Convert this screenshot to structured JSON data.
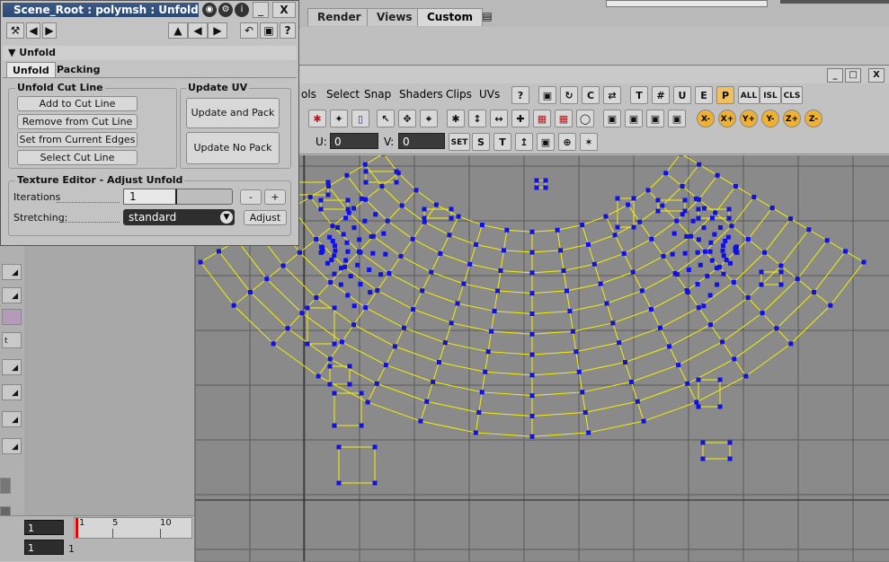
{
  "top_tabs": [
    {
      "label": "Render"
    },
    {
      "label": "Views"
    },
    {
      "label": "Custom"
    }
  ],
  "active_top_tab": "Custom",
  "panel": {
    "title": "Scene_Root : polymsh : Unfold",
    "section": "Unfold",
    "tabs": [
      "Unfold",
      "Packing"
    ],
    "cut_line": {
      "label": "Unfold Cut Line",
      "buttons": [
        "Add to Cut Line",
        "Remove from Cut Line",
        "Set from Current Edges",
        "Select Cut Line"
      ]
    },
    "update_uv": {
      "label": "Update UV",
      "buttons": [
        "Update and Pack",
        "Update No Pack"
      ]
    },
    "texture_editor": {
      "label": "Texture Editor - Adjust Unfold",
      "iterations_label": "Iterations",
      "iterations_value": "1",
      "minus": "-",
      "plus": "+",
      "stretching_label": "Stretching:",
      "stretching_value": "standard",
      "adjust_label": "Adjust"
    }
  },
  "texture_editor_window": {
    "menus": [
      "ols",
      "Select",
      "Snap",
      "Shaders",
      "Clips",
      "UVs"
    ],
    "toolbar_text_buttons": [
      "T",
      "ALL",
      "ISL",
      "CLS"
    ],
    "axis_buttons": [
      "X-",
      "X+",
      "Y+",
      "Y-",
      "Z+",
      "Z-"
    ],
    "u_label": "U:",
    "u_value": "0",
    "v_label": "V:",
    "v_value": "0",
    "set_label": "SET"
  },
  "timeline": {
    "frame_start": "1",
    "frame_current": "1",
    "ruler_marks": [
      "1",
      "5",
      "10"
    ],
    "lower_mark": "1"
  },
  "left_strip_labels": [
    "t"
  ]
}
